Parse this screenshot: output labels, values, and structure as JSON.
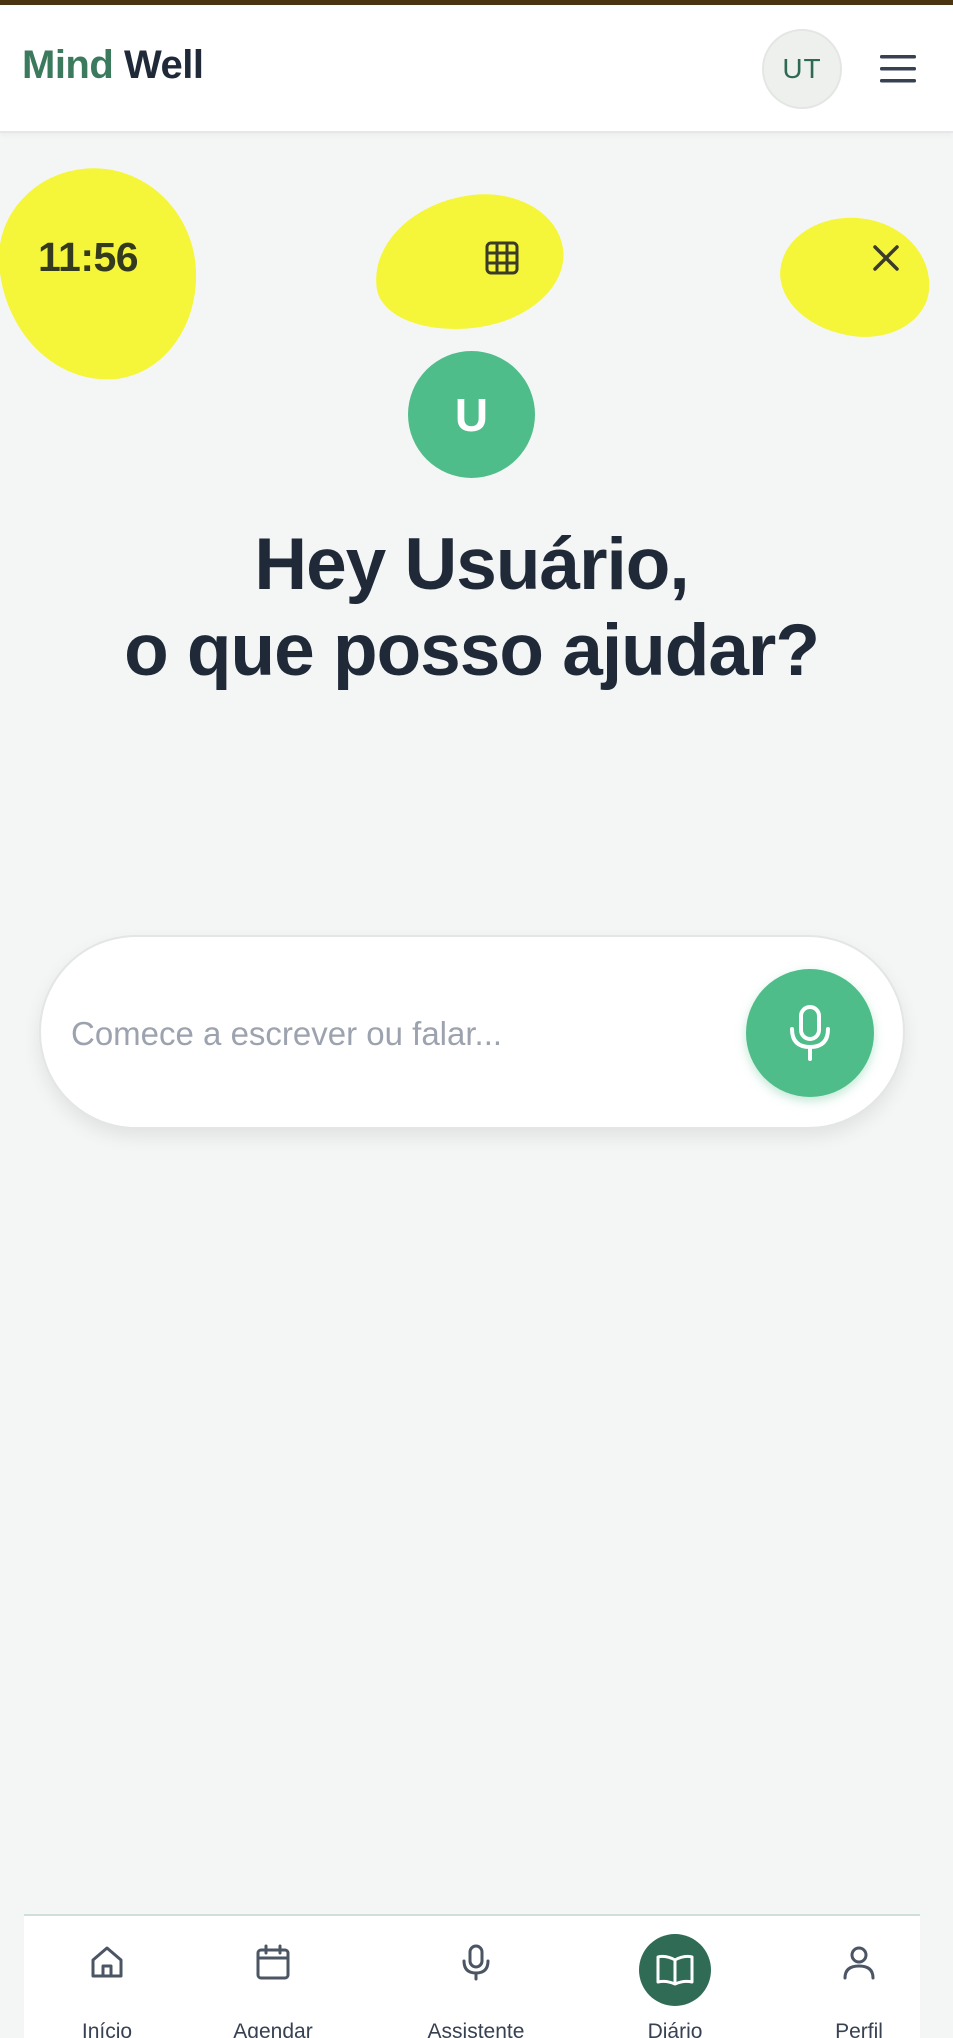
{
  "header": {
    "brand_part1": "Mind",
    "brand_part2": "Well",
    "user_initials": "UT"
  },
  "session": {
    "time": "11:56"
  },
  "assistant": {
    "avatar_letter": "U",
    "greeting_line1": "Hey Usuário,",
    "greeting_line2": "o que posso ajudar?"
  },
  "composer": {
    "placeholder": "Comece a escrever ou falar..."
  },
  "nav": {
    "items": [
      {
        "label": "Início",
        "icon": "home-icon"
      },
      {
        "label": "Agendar",
        "icon": "calendar-icon"
      },
      {
        "label": "Assistente",
        "icon": "mic-icon"
      },
      {
        "label": "Diário",
        "icon": "book-icon",
        "active": true
      },
      {
        "label": "Perfil",
        "icon": "user-icon"
      }
    ]
  },
  "colors": {
    "brand_green": "#3c7a5e",
    "accent_green": "#4fbd89",
    "active_nav": "#2f6b55",
    "highlight": "#f5f53a"
  }
}
